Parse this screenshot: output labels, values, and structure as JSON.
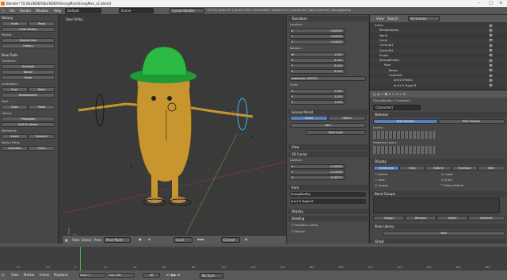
{
  "window": {
    "title": "Blender* [D:\\BLENDER\\BLENDER\\StrongMan\\StrongMan_v1.blend]"
  },
  "topbar": {
    "menus": [
      "File",
      "Render",
      "Window",
      "Help"
    ],
    "layout": "Default",
    "scene": "Scene",
    "engine": "Cycles Render",
    "stats": "v2.78 | Verts:111 | Faces:17324 | Tris:34580 | Objects:1/17 | Lamps:0/0 | Mem:116.07M | StrongManRig"
  },
  "toolshelf": {
    "history_title": "History",
    "undo": "Undo",
    "redo": "Redo",
    "undo_history": "Undo History",
    "repeat_title": "Repeat",
    "repeat_last": "Repeat Last",
    "history_btn": "History",
    "pose_tools": "Pose Tools",
    "transform": "Transform:",
    "translate": "Translate",
    "rotate": "Rotate",
    "scale": "Scale",
    "in_between": "In-Between:",
    "push": "Push",
    "relax": "Relax",
    "breakdowner": "Breakdowner",
    "pose": "Pose:",
    "copy": "Copy",
    "paste": "Paste",
    "library": "Library:",
    "propagate": "Propagate",
    "add_to_library": "Add To Library",
    "keyframes": "Keyframes:",
    "insert": "Insert",
    "remove": "Remove",
    "motion_paths": "Motion Paths:",
    "calculate": "Calculate",
    "clear": "Clear"
  },
  "viewport": {
    "label": "User Ortho",
    "status": "(48) StrongManRig : Arm1 R Target R"
  },
  "viewport_header": {
    "view": "View",
    "select": "Select",
    "pose": "Pose",
    "mode": "Pose Mode",
    "pivot": "Local",
    "overlay": "Closest"
  },
  "transform_panel": {
    "title": "Transform",
    "location": "Location:",
    "loc": [
      {
        "axis": "X:",
        "value": "0.00000"
      },
      {
        "axis": "Y:",
        "value": "0.00000"
      },
      {
        "axis": "Z:",
        "value": "0.00000"
      }
    ],
    "rotation": "Rotation:",
    "rot": [
      {
        "axis": "W:",
        "value": "1.000"
      },
      {
        "axis": "X:",
        "value": "0.000"
      },
      {
        "axis": "Y:",
        "value": "0.000"
      },
      {
        "axis": "Z:",
        "value": "0.000"
      }
    ],
    "rot_mode": "Quaternion (WXYZ)",
    "scale": "Scale:",
    "scl": [
      {
        "axis": "X:",
        "value": "1.000"
      },
      {
        "axis": "Y:",
        "value": "1.000"
      },
      {
        "axis": "Z:",
        "value": "1.000"
      }
    ]
  },
  "grease_pencil": {
    "title": "Grease Pencil",
    "scene_tab": "Scene",
    "object_tab": "Object",
    "new": "New",
    "new_layer": "New Layer"
  },
  "panels_lower": {
    "view": "View",
    "3d_cursor": "3D Cursor",
    "location": "Location:",
    "cursor": [
      {
        "axis": "X:",
        "value": "-4.26182"
      },
      {
        "axis": "Y:",
        "value": "-0.22926"
      },
      {
        "axis": "Z:",
        "value": "4.28771"
      }
    ],
    "item": "Item",
    "item_name": "StrongManRig",
    "bone_name": "Arm1 R Target R",
    "display": "Display",
    "shading": "Shading",
    "backface": "Backface Culling",
    "matcap": "Matcap"
  },
  "outliner": {
    "view": "View",
    "search": "Search",
    "filter": "All Scenes",
    "rows": [
      {
        "label": "Scene",
        "depth": 0
      },
      {
        "label": "RenderLayers",
        "depth": 1
      },
      {
        "label": "World",
        "depth": 1
      },
      {
        "label": "Circle",
        "depth": 1
      },
      {
        "label": "Circle.001",
        "depth": 1
      },
      {
        "label": "Circle.002",
        "depth": 1
      },
      {
        "label": "Empty",
        "depth": 1
      },
      {
        "label": "StrongManRig",
        "depth": 1
      },
      {
        "label": "Pose",
        "depth": 2
      },
      {
        "label": "Bones",
        "depth": 3
      },
      {
        "label": "Controller",
        "depth": 3
      },
      {
        "label": "Arm1.R.Pole.L",
        "depth": 4
      },
      {
        "label": "Arm1 R Target R",
        "depth": 4
      }
    ]
  },
  "properties": {
    "path_rig": "StrongManRig",
    "path_obj": "Character1",
    "datablock": "Character1",
    "skeleton": "Skeleton",
    "pose_position": "Pose Position",
    "rest_position": "Rest Position",
    "layers": "Layers:",
    "protected_layers": "Protected Layers:",
    "display": "Display",
    "display_types": [
      "Octahedral",
      "Stick",
      "B-Bone",
      "Envelope",
      "Wire"
    ],
    "names": "Names",
    "axes": "Axes",
    "shapes": "Shapes",
    "colors": "Colors",
    "xray": "X-Ray",
    "delay_refresh": "Delay Refresh",
    "bone_groups": "Bone Groups",
    "assign": "Assign",
    "remove": "Remove",
    "select": "Select",
    "deselect": "Deselect",
    "pose_library": "Pose Library",
    "new": "New",
    "ghost": "Ghost",
    "ghost_types": [
      "Around Frame",
      "In Range",
      "On Keyframes"
    ],
    "range": "Range:",
    "step": "Step:",
    "display_label": "Display:",
    "selected_only": "Selected Only",
    "inverse_kinematics": "Inverse Kinematics"
  },
  "timeline": {
    "menus": [
      "View",
      "Marker",
      "Frame",
      "Playback"
    ],
    "start_label": "Start:",
    "start": "1",
    "end_label": "End:",
    "end": "250",
    "current": "48",
    "sync": "No Sync",
    "ticks": [
      "-40",
      "-20",
      "0",
      "20",
      "40",
      "60",
      "80",
      "100",
      "120",
      "140",
      "160",
      "180",
      "200",
      "220",
      "240",
      "260",
      "280"
    ]
  },
  "colors": {
    "accent": "#5680c2",
    "bg": "#3a3a3a",
    "panel": "#474747",
    "hat": "#22a43a",
    "body": "#c8962e"
  }
}
